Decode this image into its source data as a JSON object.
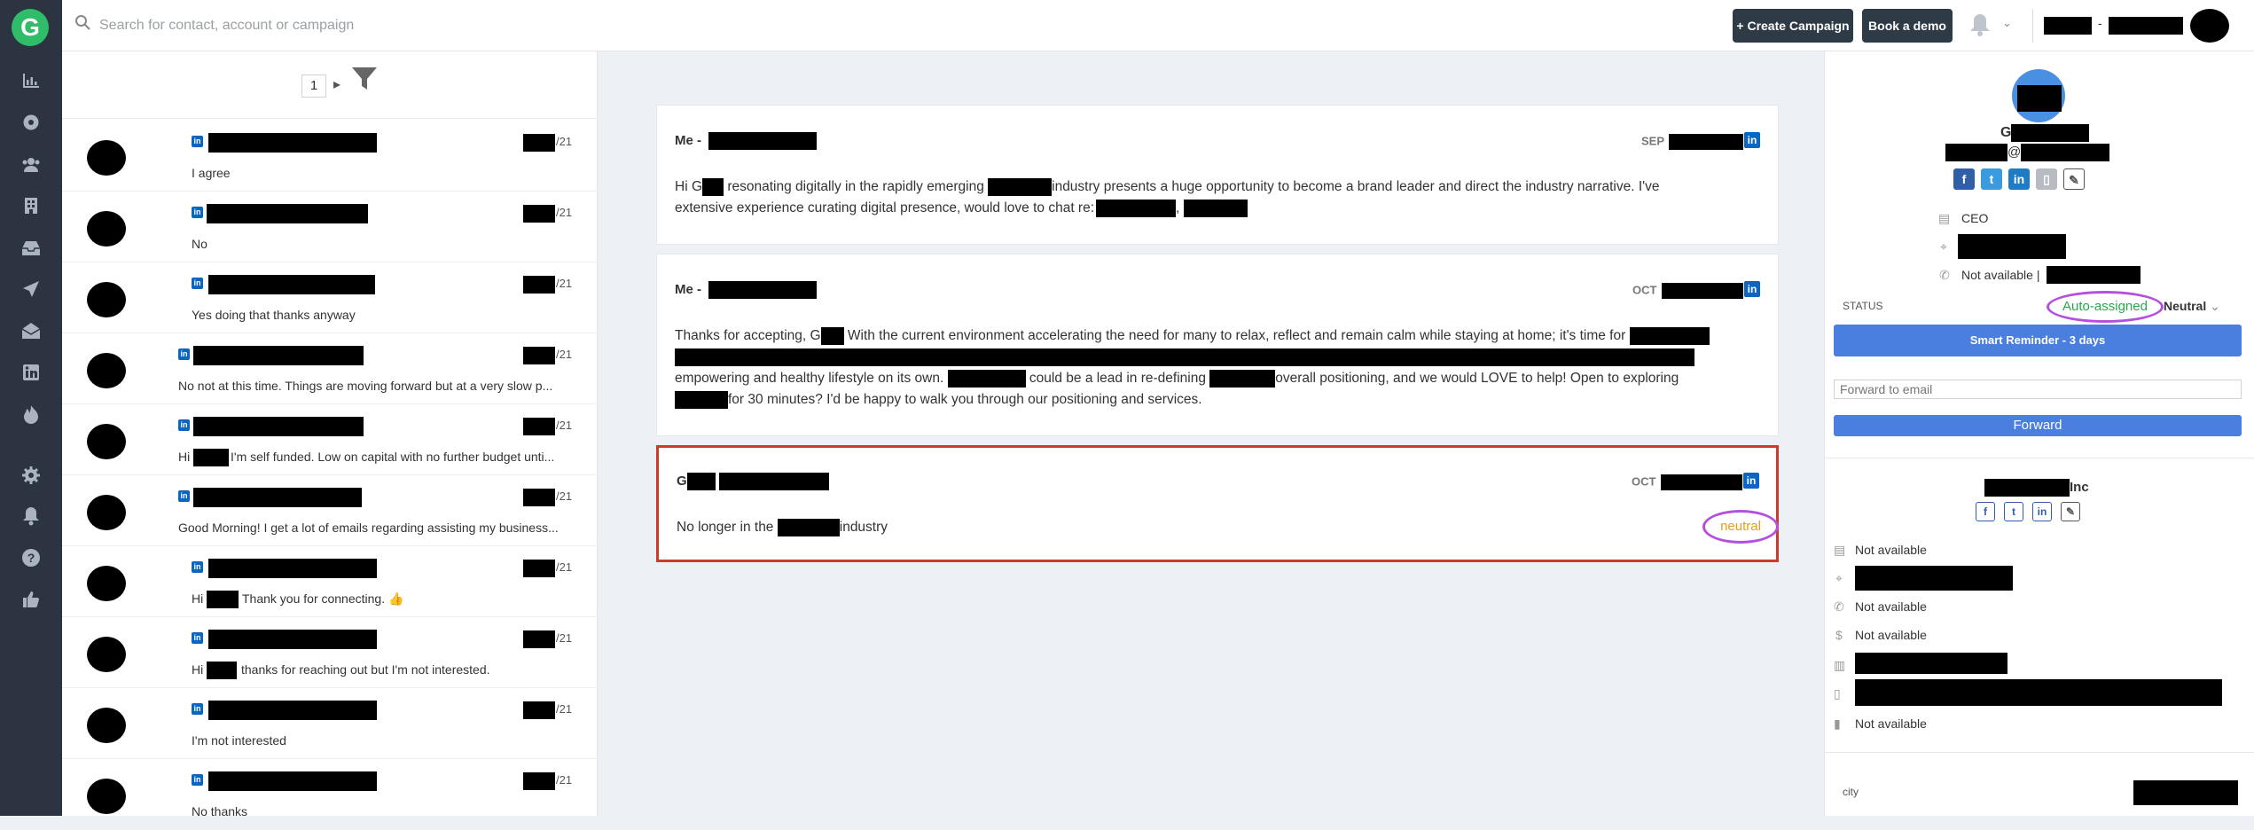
{
  "app": {
    "logo_letter": "G"
  },
  "rail": {
    "icons": [
      "logo-icon",
      "chart-icon",
      "compass-icon",
      "users-icon",
      "building-icon",
      "inbox-icon",
      "send-icon",
      "mail-open-icon",
      "linkedin-icon",
      "fire-icon",
      "gear-icon",
      "bell-icon",
      "help-icon",
      "thumbs-up-icon"
    ]
  },
  "topbar": {
    "search_placeholder": "Search for contact, account or campaign",
    "create_campaign": "+ Create Campaign",
    "book_demo": "Book a demo"
  },
  "list": {
    "page": "1",
    "items": [
      {
        "year": "/21",
        "message": "I agree"
      },
      {
        "year": "/21",
        "message": "No"
      },
      {
        "year": "/21",
        "message": "Yes doing that thanks anyway"
      },
      {
        "year": "/21",
        "message": "No not at this time. Things are moving forward but at a very slow p..."
      },
      {
        "year": "/21",
        "message_pre": "Hi",
        "message": "I'm self funded. Low on capital with no further budget unti..."
      },
      {
        "year": "/21",
        "message": "Good Morning! I get a lot of emails regarding assisting my business..."
      },
      {
        "year": "/21",
        "message_pre": "Hi",
        "message": "Thank you for connecting. 👍"
      },
      {
        "year": "/21",
        "message_pre": "Hi",
        "message": "thanks for reaching out but I'm not interested."
      },
      {
        "year": "/21",
        "message": "I'm not interested"
      },
      {
        "year": "/21",
        "message": "No thanks"
      }
    ]
  },
  "conversation": {
    "messages": [
      {
        "sender": "Me -",
        "month": "SEP",
        "p1": "Hi G",
        "p2": "resonating digitally in the rapidly emerging",
        "p3": "industry presents a huge opportunity to become a brand leader and direct the industry narrative. I've",
        "p4": "extensive experience curating digital presence, would love to chat re:",
        "p5": ","
      },
      {
        "sender": "Me -",
        "month": "OCT",
        "p1": "Thanks for accepting, G",
        "p2": "With the current environment accelerating the need for many to relax, reflect and remain calm while staying at home; it's time for",
        "p3": "empowering and healthy lifestyle on its own.",
        "p4": "could be a lead in re-defining",
        "p5": "overall positioning, and we would LOVE to help! Open to exploring",
        "p6": "for 30 minutes? I'd be happy to walk you through our positioning and services."
      },
      {
        "sender": "G",
        "month": "OCT",
        "p1": "No longer in the",
        "p2": "industry",
        "sentiment": "neutral"
      }
    ]
  },
  "contact": {
    "initial": "G",
    "email_at": "@",
    "title": "CEO",
    "phone": "Not available |",
    "status_label": "STATUS",
    "status_value": "Auto-assigned",
    "sentiment": "Neutral",
    "reminder_button": "Smart Reminder - 3 days",
    "forward_placeholder": "Forward to email",
    "forward_button": "Forward"
  },
  "company": {
    "suffix": "Inc",
    "size": "Not available",
    "phone": "Not available",
    "revenue": "Not available",
    "other": "Not available",
    "city_label": "city"
  },
  "colors": {
    "accent_blue": "#4a7fe0",
    "status_green": "#2aa84a",
    "highlight_purple": "#b44fe0",
    "selected_red": "#cc3a2a",
    "neutral_orange": "#e0a020"
  }
}
